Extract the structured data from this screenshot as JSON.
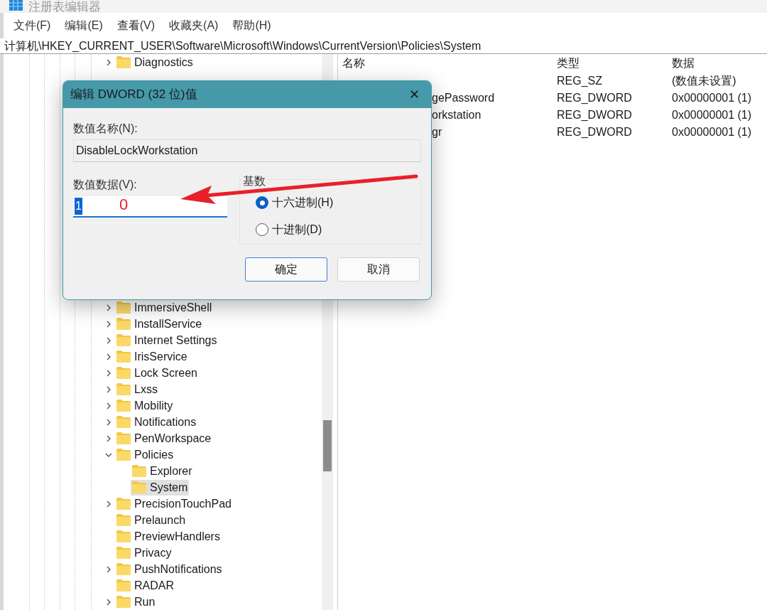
{
  "window": {
    "title": "注册表编辑器"
  },
  "menu": [
    {
      "label": "文件(F)"
    },
    {
      "label": "编辑(E)"
    },
    {
      "label": "查看(V)"
    },
    {
      "label": "收藏夹(A)"
    },
    {
      "label": "帮助(H)"
    }
  ],
  "address": "计算机\\HKEY_CURRENT_USER\\Software\\Microsoft\\Windows\\CurrentVersion\\Policies\\System",
  "tree": {
    "items_top": [
      {
        "label": "Diagnostics",
        "has_children": true,
        "expanded": false,
        "selected": false
      }
    ],
    "items_bottom": [
      {
        "label": "ImmersiveShell",
        "has_children": true,
        "expanded": false,
        "selected": false
      },
      {
        "label": "InstallService",
        "has_children": true,
        "expanded": false,
        "selected": false
      },
      {
        "label": "Internet Settings",
        "has_children": true,
        "expanded": false,
        "selected": false
      },
      {
        "label": "IrisService",
        "has_children": true,
        "expanded": false,
        "selected": false
      },
      {
        "label": "Lock Screen",
        "has_children": true,
        "expanded": false,
        "selected": false
      },
      {
        "label": "Lxss",
        "has_children": true,
        "expanded": false,
        "selected": false
      },
      {
        "label": "Mobility",
        "has_children": true,
        "expanded": false,
        "selected": false
      },
      {
        "label": "Notifications",
        "has_children": true,
        "expanded": false,
        "selected": false
      },
      {
        "label": "PenWorkspace",
        "has_children": true,
        "expanded": false,
        "selected": false
      },
      {
        "label": "Policies",
        "has_children": true,
        "expanded": true,
        "selected": false,
        "children": [
          {
            "label": "Explorer",
            "has_children": false,
            "selected": false
          },
          {
            "label": "System",
            "has_children": false,
            "selected": true
          }
        ]
      },
      {
        "label": "PrecisionTouchPad",
        "has_children": true,
        "expanded": false,
        "selected": false
      },
      {
        "label": "Prelaunch",
        "has_children": false,
        "selected": false
      },
      {
        "label": "PreviewHandlers",
        "has_children": false,
        "selected": false
      },
      {
        "label": "Privacy",
        "has_children": false,
        "selected": false
      },
      {
        "label": "PushNotifications",
        "has_children": true,
        "expanded": false,
        "selected": false
      },
      {
        "label": "RADAR",
        "has_children": false,
        "selected": false
      },
      {
        "label": "Run",
        "has_children": true,
        "expanded": false,
        "selected": false
      }
    ]
  },
  "values": {
    "columns": [
      "名称",
      "类型",
      "数据"
    ],
    "rows": [
      {
        "type": "REG_SZ",
        "data": "(数值未设置)"
      },
      {
        "name": "gePassword",
        "type": "REG_DWORD",
        "data": "0x00000001 (1)"
      },
      {
        "name": "orkstation",
        "type": "REG_DWORD",
        "data": "0x00000001 (1)"
      },
      {
        "name": "gr",
        "type": "REG_DWORD",
        "data": "0x00000001 (1)"
      }
    ]
  },
  "dialog": {
    "title": "编辑 DWORD (32 位)值",
    "close": "✕",
    "name_label": "数值名称(N):",
    "name_value": "DisableLockWorkstation",
    "data_label": "数值数据(V):",
    "data_value": "1",
    "data_selected": true,
    "base_label": "基数",
    "radios": [
      {
        "label": "十六进制(H)",
        "selected": true
      },
      {
        "label": "十进制(D)",
        "selected": false
      }
    ],
    "buttons": [
      {
        "label": "确定",
        "default": true
      },
      {
        "label": "取消",
        "default": false
      }
    ]
  },
  "annotation": {
    "text": "0"
  }
}
